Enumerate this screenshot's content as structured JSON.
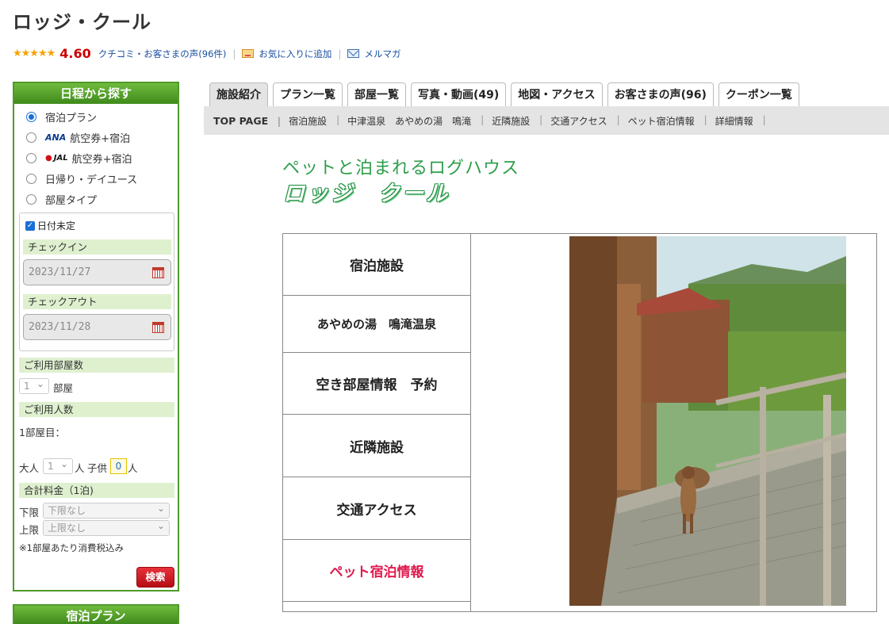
{
  "hotel": {
    "name": "ロッジ・クール",
    "stars": "★★★★★",
    "rating": "4.60"
  },
  "meta": {
    "reviews_link": "クチコミ・お客さまの声(96件)",
    "favorite_link": "お気に入りに追加",
    "mail_link": "メルマガ"
  },
  "sidebar": {
    "title": "日程から探す",
    "options": [
      {
        "label": "宿泊プラン",
        "checked": true
      },
      {
        "logo": "ANA",
        "label": "航空券+宿泊"
      },
      {
        "logo": "JAL",
        "label": "航空券+宿泊"
      },
      {
        "label": "日帰り・デイユース"
      },
      {
        "label": "部屋タイプ"
      }
    ],
    "date_undecided": "日付未定",
    "checkin_label": "チェックイン",
    "checkin_value": "2023/11/27",
    "checkout_label": "チェックアウト",
    "checkout_value": "2023/11/28",
    "rooms_label": "ご利用部屋数",
    "rooms_value": "1",
    "rooms_unit": "部屋",
    "guests_label": "ご利用人数",
    "room1_label": "1部屋目：",
    "adult_label": "大人",
    "adult_value": "1",
    "person_unit": "人",
    "child_label": "子供",
    "child_value": "0",
    "price_label": "合計料金（1泊)",
    "min_label": "下限",
    "min_value": "下限なし",
    "max_label": "上限",
    "max_value": "上限なし",
    "tax_note": "※1部屋あたり消費税込み",
    "search_button": "検索",
    "plan_header": "宿泊プラン"
  },
  "tabs": [
    "施設紹介",
    "プラン一覧",
    "部屋一覧",
    "写真・動画(49)",
    "地図・アクセス",
    "お客さまの声(96)",
    "クーポン一覧"
  ],
  "subnav": [
    "TOP PAGE",
    "宿泊施設",
    "中津温泉　あやめの湯　鳴滝",
    "近隣施設",
    "交通アクセス",
    "ペット宿泊情報",
    "詳細情報"
  ],
  "content": {
    "tagline": "ペットと泊まれるログハウス",
    "brand": "ロッジ　クール",
    "menu": [
      "宿泊施設",
      "あやめの湯　鳴滝温泉",
      "空き部屋情報　予約",
      "近隣施設",
      "交通アクセス",
      "ペット宿泊情報"
    ]
  },
  "colors": {
    "accent_green": "#4f9a2a",
    "rating_red": "#cc0000",
    "pet_pink": "#e0194d"
  }
}
